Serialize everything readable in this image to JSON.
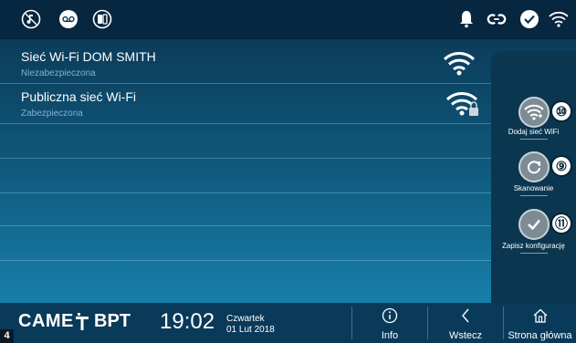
{
  "status_bar": {
    "left_icons": [
      "music-mute-icon",
      "voicemail-icon",
      "door-phone-icon"
    ],
    "right_icons": [
      "bell-icon",
      "link-icon",
      "checkmark-icon",
      "wifi-icon"
    ]
  },
  "networks": [
    {
      "name": "Sieć Wi-Fi DOM SMITH",
      "security": "Niezabezpieczona",
      "icon": "wifi-signal-icon"
    },
    {
      "name": "Publiczna sieć Wi-Fi",
      "security": "Zabezpieczona",
      "icon": "wifi-locked-icon"
    }
  ],
  "actions": [
    {
      "label": "Dodaj sieć WiFi",
      "number": "⑩",
      "icon": "add-wifi-icon"
    },
    {
      "label": "Skanowanie",
      "number": "⑨",
      "icon": "refresh-icon"
    },
    {
      "label": "Zapisz konfigurację",
      "number": "⑪",
      "icon": "check-icon"
    }
  ],
  "footer": {
    "brand_came": "CAME",
    "brand_bpt": "BPT",
    "time": "19:02",
    "day": "Czwartek",
    "date": "01 Lut 2018",
    "info_label": "Info",
    "back_label": "Wstecz",
    "home_label": "Strona główna"
  },
  "page_number": "4",
  "colors": {
    "accent": "#1a8ab6",
    "panel": "#0b3650",
    "topbar": "#072640"
  }
}
